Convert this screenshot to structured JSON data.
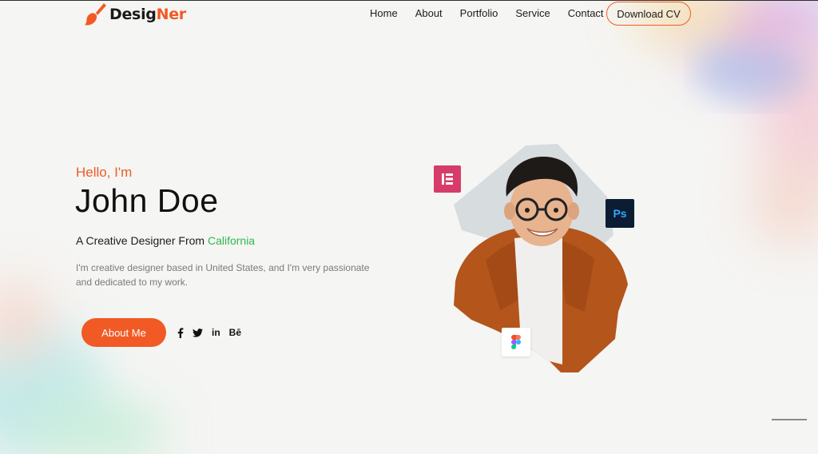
{
  "brand": {
    "logo_main": "Desig",
    "logo_accent": "Ner"
  },
  "nav": {
    "items": [
      {
        "label": "Home"
      },
      {
        "label": "About"
      },
      {
        "label": "Portfolio"
      },
      {
        "label": "Service"
      },
      {
        "label": "Contact"
      }
    ],
    "cta_label": "Download CV"
  },
  "hero": {
    "greeting": "Hello, I'm",
    "name": "John Doe",
    "tagline_prefix": "A Creative Designer From ",
    "tagline_highlight": "California",
    "description": "I'm creative designer based in United States, and I'm very passionate and dedicated to my work.",
    "button_label": "About Me"
  },
  "social": [
    {
      "icon": "facebook-icon",
      "glyph": "f"
    },
    {
      "icon": "twitter-icon",
      "glyph": ""
    },
    {
      "icon": "linkedin-icon",
      "glyph": "in"
    },
    {
      "icon": "behance-icon",
      "glyph": "Bē"
    }
  ],
  "tool_badges": [
    {
      "icon": "elementor-icon"
    },
    {
      "icon": "photoshop-icon",
      "label": "Ps"
    },
    {
      "icon": "figma-icon"
    }
  ],
  "colors": {
    "accent": "#f15a24",
    "highlight": "#2fb84f",
    "elementor": "#d63c6a",
    "photoshop_bg": "#0b1c33",
    "photoshop_fg": "#31a8ff"
  }
}
